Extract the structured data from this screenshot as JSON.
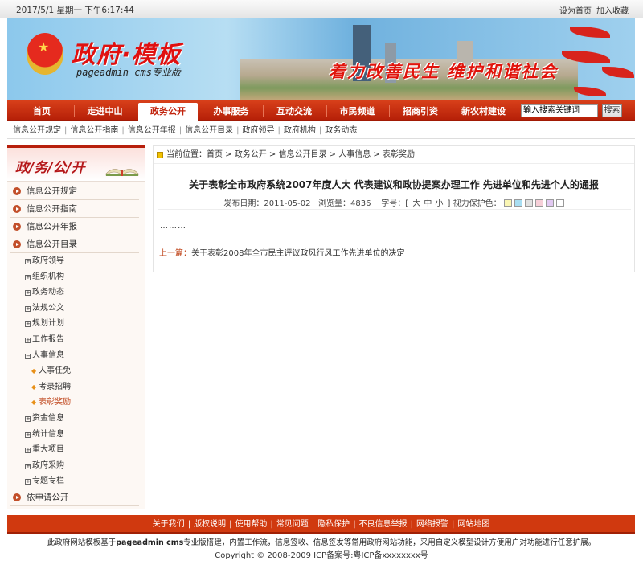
{
  "topbar": {
    "datetime": "2017/5/1 星期一 下午6:17:44",
    "set_home": "设为首页",
    "add_favorite": "加入收藏"
  },
  "banner": {
    "logo_title": "政府·模板",
    "logo_sub": "pageadmin cms专业版",
    "slogan": "着力改善民生 维护和谐社会"
  },
  "nav": {
    "items": [
      "首页",
      "走进中山",
      "政务公开",
      "办事服务",
      "互动交流",
      "市民频道",
      "招商引资",
      "新农村建设"
    ],
    "active": "政务公开",
    "search_placeholder": "输入搜索关键词",
    "search_button": "搜索"
  },
  "subnav": [
    "信息公开规定",
    "信息公开指南",
    "信息公开年报",
    "信息公开目录",
    "政府领导",
    "政府机构",
    "政务动态"
  ],
  "sidebar": {
    "title": "政/务/公/开",
    "top": [
      "信息公开规定",
      "信息公开指南",
      "信息公开年报",
      "信息公开目录"
    ],
    "catalog": [
      "政府领导",
      "组织机构",
      "政务动态",
      "法规公文",
      "规划计划",
      "工作报告"
    ],
    "expanded": "人事信息",
    "children": [
      "人事任免",
      "考录招聘",
      "表彰奖励"
    ],
    "current": "表彰奖励",
    "catalog_after": [
      "资金信息",
      "统计信息",
      "重大项目",
      "政府采购",
      "专题专栏"
    ],
    "last": "依申请公开"
  },
  "breadcrumb": {
    "label": "当前位置：",
    "items": [
      "首页",
      "政务公开",
      "信息公开目录",
      "人事信息",
      "表彰奖励"
    ]
  },
  "article": {
    "title": "关于表彰全市政府系统2007年度人大 代表建议和政协提案办理工作 先进单位和先进个人的通报",
    "date_label": "发布日期：",
    "date": "2011-05-02",
    "views_label": "浏览量：",
    "views": "4836",
    "font_label": "字号：[",
    "font_sizes": [
      "大",
      "中",
      "小"
    ],
    "font_close": "]",
    "eye_label": "视力保护色：",
    "eye_colors": [
      "#faf6b4",
      "#a9def2",
      "#e0e0e0",
      "#f6cfd8",
      "#e2c9f2",
      "#ffffff"
    ],
    "body": "………",
    "prev_label": "上一篇：",
    "prev_title": "关于表彰2008年全市民主评议政风行风工作先进单位的决定"
  },
  "footer": {
    "links": [
      "关于我们",
      "版权说明",
      "使用帮助",
      "常见问题",
      "隐私保护",
      "不良信息举报",
      "网络报警",
      "网站地图"
    ],
    "desc_pre": "此政府网站模板基于",
    "desc_bold": "pageadmin cms",
    "desc_post": "专业版搭建，内置工作流，信息签收、信息签发等常用政府网站功能，采用自定义模型设计方便用户对功能进行任意扩展。",
    "copyright": "Copyright © 2008-2009 ICP备案号:粤ICP备xxxxxxxx号"
  }
}
